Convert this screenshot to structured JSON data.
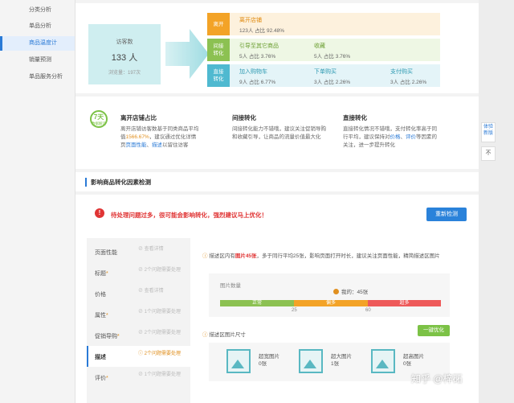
{
  "sidebar": {
    "items": [
      {
        "label": "分类分析"
      },
      {
        "label": "单品分析"
      },
      {
        "label": "商品温度计"
      },
      {
        "label": "销量预测"
      },
      {
        "label": "单品服务分析"
      }
    ]
  },
  "visitors": {
    "label": "访客数",
    "count": "133 人",
    "pv": "浏览量：197次"
  },
  "flow": {
    "leave": {
      "tag": "离开",
      "title": "离开店铺",
      "value": "123人 占比 92.48%",
      "color": "#f3a327"
    },
    "indirect": {
      "tag": "间接\n转化",
      "color": "#8cc152",
      "cells": [
        {
          "title": "引导至其它商品",
          "value": "5人 占比 3.76%"
        },
        {
          "title": "收藏",
          "value": "5人 占比 3.76%"
        }
      ]
    },
    "direct": {
      "tag": "直接\n转化",
      "color": "#4fb9d0",
      "cells": [
        {
          "title": "加入购物车",
          "value": "9人 占比 6.77%"
        },
        {
          "title": "下单购买",
          "value": "3人 占比 2.26%"
        },
        {
          "title": "支付购买",
          "value": "3人 占比 2.26%"
        }
      ]
    }
  },
  "badge": {
    "big": "7天",
    "small": "数据解读"
  },
  "explain": {
    "leave": {
      "title": "离开店铺占比",
      "p1": "离开店铺访客数基于同类商品平均",
      "p2": "值",
      "rate": "1566.67%",
      "p3": "，建议通过优化详情",
      "p4": "页",
      "link1": "页面性能",
      "sep": "、",
      "link2": "描述",
      "p5": "以留住访客"
    },
    "indirect": {
      "title": "间接转化",
      "text": "间接转化能力不错哦，建议关注促销导购和收藏引导，让商品的流量价值最大化"
    },
    "direct": {
      "title": "直接转化",
      "p1": "直接转化情况不错哦，支付转化率高于同行平均，建议保持对",
      "link1": "价格",
      "sep": "、",
      "link2": "评价",
      "p2": "等因素的关注，进一步提升转化"
    }
  },
  "section": {
    "title": "影响商品转化因素检测"
  },
  "warning": {
    "icon": "!",
    "text": "待处理问题过多，很可能会影响转化，强烈建议马上优化！",
    "button": "重新检测"
  },
  "menu": [
    {
      "name": "页面性能",
      "star": "",
      "status": "⊘ 查看详情"
    },
    {
      "name": "标题",
      "star": "*",
      "status": "⊘ 2个问题需要处理"
    },
    {
      "name": "价格",
      "star": "",
      "status": "⊘ 查看详情"
    },
    {
      "name": "属性",
      "star": "*",
      "status": "⊘ 1个问题需要处理"
    },
    {
      "name": "促销导购",
      "star": "*",
      "status": "⊘ 2个问题需要处理"
    },
    {
      "name": "描述",
      "star": "",
      "status": "ⓘ 2个问题需要处理"
    },
    {
      "name": "评价",
      "star": "*",
      "status": "⊘ 1个问题需要处理"
    }
  ],
  "detail": {
    "info1_a": "描述区内有",
    "info1_red": "图片45张",
    "info1_b": "，多于同行平均25张，影响页面打开时长，建议关注页面性能，精简描述区图片",
    "count_label": "图片数量",
    "mine": "我的：45张",
    "segments": [
      "正常",
      "偏多",
      "超多"
    ],
    "ticks": [
      "25",
      "60"
    ],
    "value": 45,
    "info2": "描述区图片尺寸",
    "onekey": "一键优化",
    "sizes": [
      {
        "label": "超宽图片",
        "value": "0张"
      },
      {
        "label": "超大图片",
        "value": "1张"
      },
      {
        "label": "超高图片",
        "value": "0张"
      }
    ]
  },
  "side": {
    "feedback": "体验新版",
    "collapse": "不"
  },
  "watermark": "知乎 @梓砳"
}
